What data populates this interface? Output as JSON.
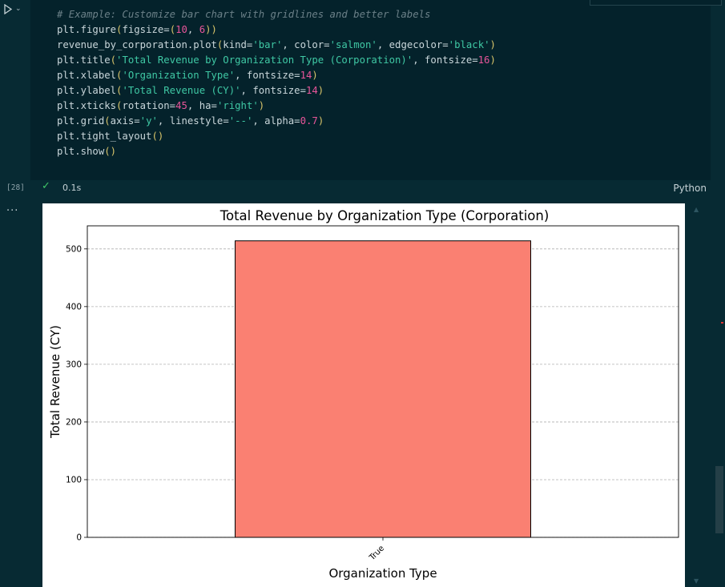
{
  "cell": {
    "code_lines": [
      "# Example: Customize bar chart with gridlines and better labels",
      "plt.figure(figsize=(10, 6))",
      "revenue_by_corporation.plot(kind='bar', color='salmon', edgecolor='black')",
      "plt.title('Total Revenue by Organization Type (Corporation)', fontsize=16)",
      "plt.xlabel('Organization Type', fontsize=14)",
      "plt.ylabel('Total Revenue (CY)', fontsize=14)",
      "plt.xticks(rotation=45, ha='right')",
      "plt.grid(axis='y', linestyle='--', alpha=0.7)",
      "plt.tight_layout()",
      "plt.show()"
    ],
    "execution_count": "[28]",
    "duration": "0.1s",
    "language": "Python",
    "output_menu": "..."
  },
  "colors": {
    "bar_fill": "#fa8072",
    "bar_edge": "#000000",
    "editor_bg": "#04222b",
    "success": "#3fc869"
  },
  "chart_data": {
    "type": "bar",
    "title": "Total Revenue by Organization Type (Corporation)",
    "xlabel": "Organization Type",
    "ylabel": "Total Revenue (CY)",
    "categories": [
      "True"
    ],
    "values": [
      514
    ],
    "ylim": [
      0,
      540
    ],
    "yticks": [
      0,
      100,
      200,
      300,
      400,
      500
    ],
    "grid": "y dashed"
  }
}
